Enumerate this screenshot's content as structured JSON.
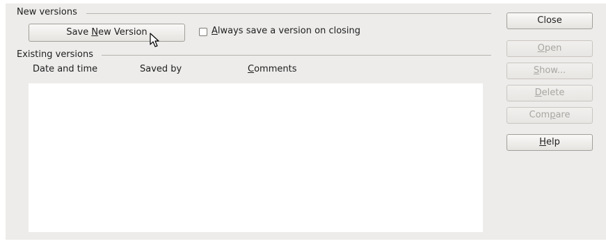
{
  "new_versions": {
    "section_label": "New versions",
    "save_button_label": "Save New Version",
    "save_button_mnemonic": "N",
    "always_save_label": "Always save a version on closing",
    "always_save_checked": false
  },
  "existing_versions": {
    "section_label": "Existing versions",
    "columns": [
      "Date and time",
      "Saved by",
      "Comments"
    ],
    "rows": []
  },
  "side_buttons": {
    "close": "Close",
    "open": "Open",
    "show": "Show...",
    "delete": "Delete",
    "compare": "Compare",
    "help": "Help"
  },
  "icons": {
    "pointer": "mouse-pointer-icon"
  }
}
